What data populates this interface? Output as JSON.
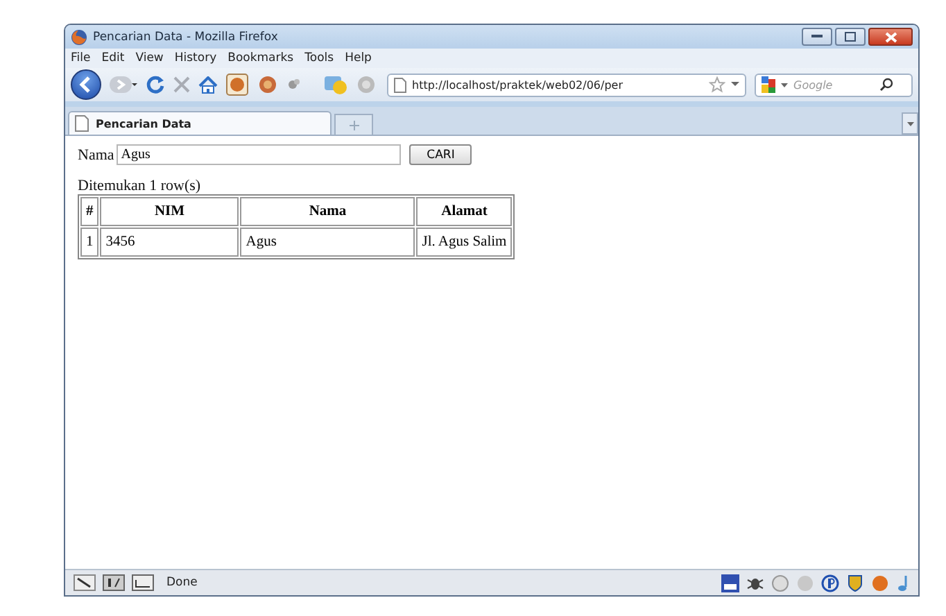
{
  "window": {
    "title": "Pencarian Data - Mozilla Firefox"
  },
  "menu": [
    "File",
    "Edit",
    "View",
    "History",
    "Bookmarks",
    "Tools",
    "Help"
  ],
  "toolbar": {
    "url": "http://localhost/praktek/web02/06/per",
    "search_placeholder": "Google"
  },
  "tabs": [
    {
      "label": "Pencarian Data",
      "selected": true
    }
  ],
  "form": {
    "label": "Nama",
    "value": "Agus",
    "button": "CARI"
  },
  "result": "Ditemukan 1 row(s)",
  "table": {
    "columns": [
      "#",
      "NIM",
      "Nama",
      "Alamat"
    ],
    "rows": [
      [
        "1",
        "3456",
        "Agus",
        "Jl. Agus Salim"
      ]
    ]
  },
  "status_bar": {
    "text": "Done"
  }
}
